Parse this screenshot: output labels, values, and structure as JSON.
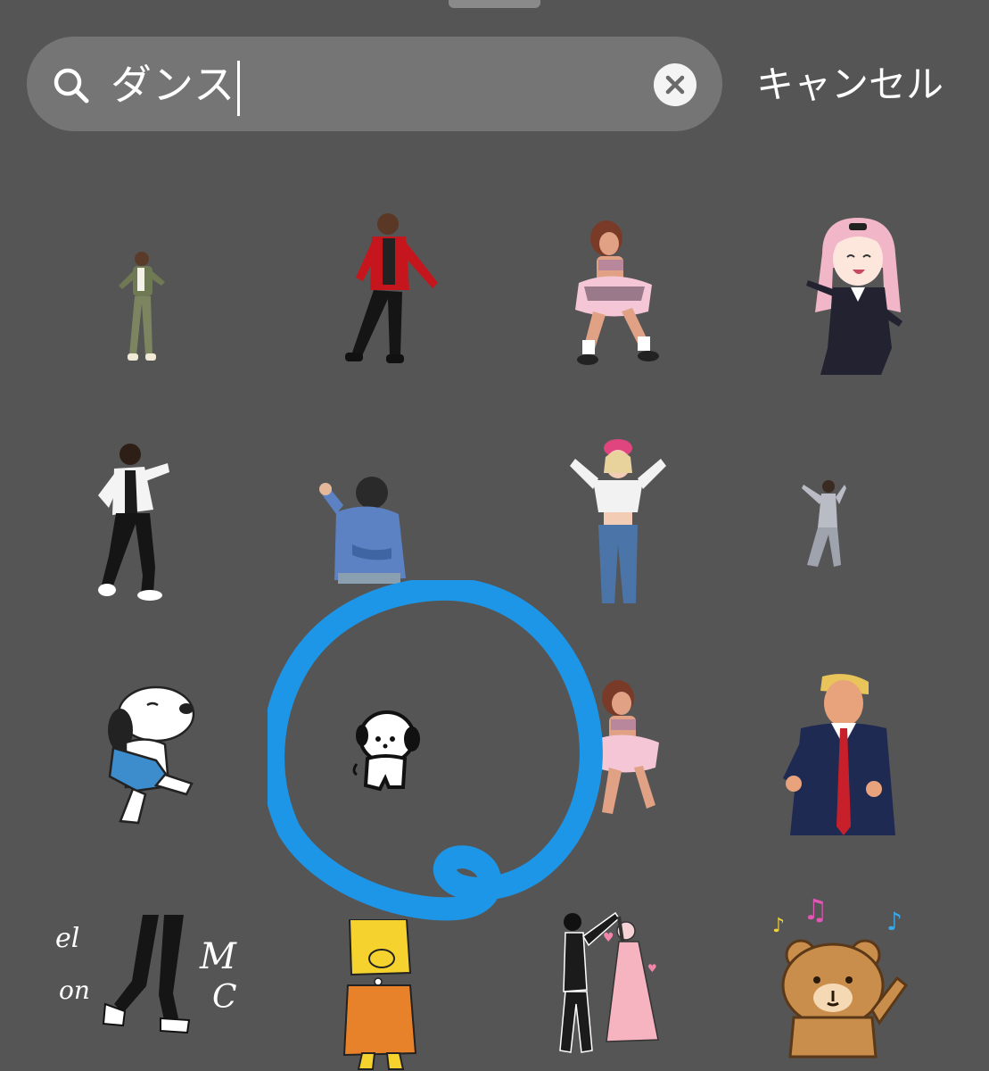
{
  "search": {
    "query": "ダンス",
    "clear_label": "×"
  },
  "cancel_label": "キャンセル",
  "colors": {
    "background": "#555555",
    "search_field": "#757575",
    "annotation": "#1e96e8"
  },
  "stickers": [
    {
      "name": "dancing-man-green-outfit"
    },
    {
      "name": "dancing-man-red-jacket"
    },
    {
      "name": "dancing-girl-pink-skirt"
    },
    {
      "name": "anime-girl-pink-hair"
    },
    {
      "name": "dancing-man-white-shirt"
    },
    {
      "name": "dancing-man-denim-jacket"
    },
    {
      "name": "dancing-woman-pink-cap"
    },
    {
      "name": "dancing-woman-small"
    },
    {
      "name": "snoopy-dancing"
    },
    {
      "name": "cartoon-dog-dancing"
    },
    {
      "name": "dancing-girl-pink-skirt-repeat"
    },
    {
      "name": "politician-dancing"
    },
    {
      "name": "dance-legs-script-text"
    },
    {
      "name": "cartoon-yellow-character"
    },
    {
      "name": "couple-dancing"
    },
    {
      "name": "bear-with-music-notes"
    }
  ],
  "annotation": {
    "type": "hand-drawn-circle",
    "highlights": "cartoon-dog-dancing"
  }
}
